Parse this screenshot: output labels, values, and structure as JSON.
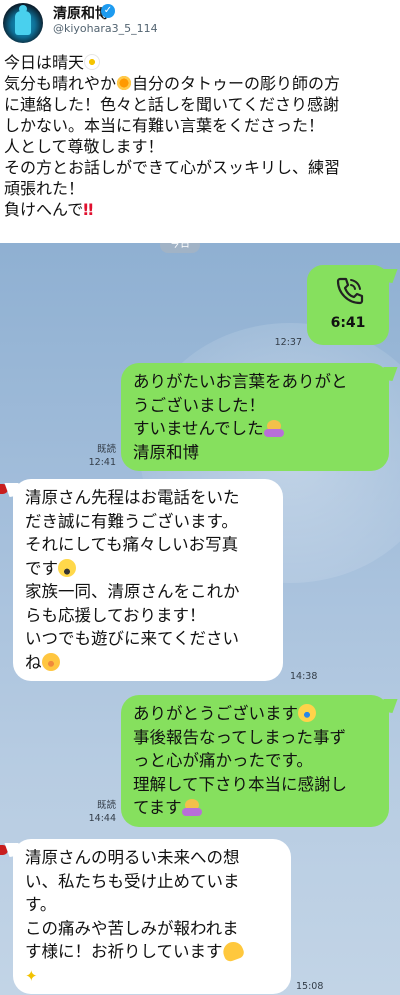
{
  "tweet": {
    "display_name": "清原和博",
    "handle": "@kiyohara3_5_114",
    "avatar_icon": "baseball-player-avatar",
    "lines": [
      {
        "pre": "今日は晴天",
        "emoji": "daisy-icon",
        "post": ""
      },
      {
        "pre": "気分も晴れやか",
        "emoji": "sun-icon",
        "post": "自分のタトゥーの彫り師の方"
      },
      {
        "pre": "に連絡した！色々と話しを聞いてくださり感謝",
        "emoji": "",
        "post": ""
      },
      {
        "pre": "しかない。本当に有難い言葉をくださった！",
        "emoji": "",
        "post": ""
      },
      {
        "pre": "人として尊敬します！",
        "emoji": "",
        "post": ""
      },
      {
        "pre": "その方とお話しができて心がスッキリし、練習",
        "emoji": "",
        "post": ""
      },
      {
        "pre": "頑張れた！",
        "emoji": "",
        "post": ""
      },
      {
        "pre": "負けへんで",
        "emoji": "double-exclamation-icon",
        "post": "‼"
      }
    ]
  },
  "chat": {
    "date_label": "今日",
    "call": {
      "duration": "6:41",
      "time": "12:37"
    },
    "messages": [
      {
        "side": "mine",
        "lines": [
          "ありがたいお言葉をありがと",
          "うございました！",
          "すいませんでした",
          "清原和博"
        ],
        "read": "既読",
        "time": "12:41"
      },
      {
        "side": "theirs",
        "lines": [
          "清原さん先程はお電話をいた",
          "だき誠に有難うございます。",
          "それにしても痛々しいお写真",
          "です",
          "家族一同、清原さんをこれか",
          "らも応援しております！",
          "いつでも遊びに来てください",
          "ね"
        ],
        "time": "14:38"
      },
      {
        "side": "mine",
        "lines": [
          "ありがとうございます",
          "事後報告なってしまった事ず",
          "っと心が痛かったです。",
          "理解して下さり本当に感謝し",
          "てます"
        ],
        "read": "既読",
        "time": "14:44"
      },
      {
        "side": "theirs",
        "lines": [
          "清原さんの明るい未来への想",
          "い、私たちも受け止めていま",
          "す。",
          "この痛みや苦しみが報われま",
          "す様に！お祈りしています"
        ],
        "time": "15:08"
      }
    ]
  },
  "colors": {
    "line_green": "#86e05e",
    "chat_background": "#a6c0dc",
    "verified_blue": "#1d9bf0"
  }
}
